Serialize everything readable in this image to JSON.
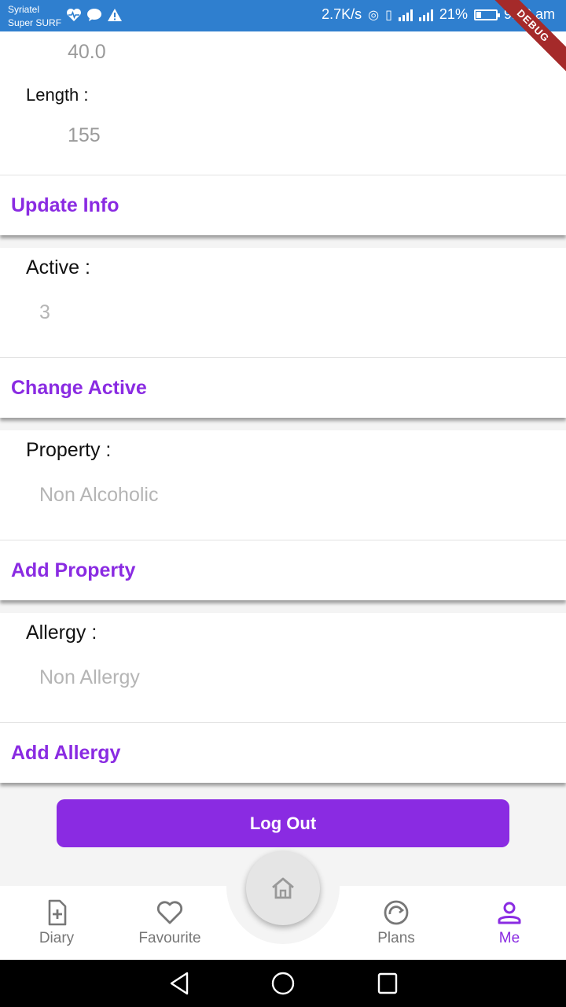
{
  "status_bar": {
    "carrier_line1": "Syriatel",
    "carrier_line2": "Super SURF",
    "left_icons": [
      "heart-pulse-icon",
      "chat-icon",
      "warning-icon"
    ],
    "speed": "2.7K/s",
    "battery": "21%",
    "time": "9:00 am",
    "background": "#2f7fcf"
  },
  "debug_banner": "DEBUG",
  "weight_section": {
    "weight_value": "40.0",
    "length_label": "Length :",
    "length_value": "155",
    "action": "Update Info"
  },
  "active_section": {
    "label": "Active  :",
    "value": "3",
    "action": "Change Active"
  },
  "property_section": {
    "label": "Property  :",
    "value": "Non Alcoholic",
    "action": "Add Property"
  },
  "allergy_section": {
    "label": "Allergy  :",
    "value": "Non Allergy",
    "action": "Add Allergy"
  },
  "logout_label": "Log Out",
  "bottom_nav": {
    "items": [
      {
        "label": "Diary",
        "icon": "diary-icon"
      },
      {
        "label": "Favourite",
        "icon": "heart-icon"
      },
      {
        "label": "Home",
        "icon": "home-icon"
      },
      {
        "label": "Plans",
        "icon": "plans-icon"
      },
      {
        "label": "Me",
        "icon": "person-icon"
      }
    ],
    "active": "Me"
  },
  "colors": {
    "accent": "#8a2be2",
    "status_bar": "#2f7fcf",
    "muted_text": "#b5b5b5"
  }
}
